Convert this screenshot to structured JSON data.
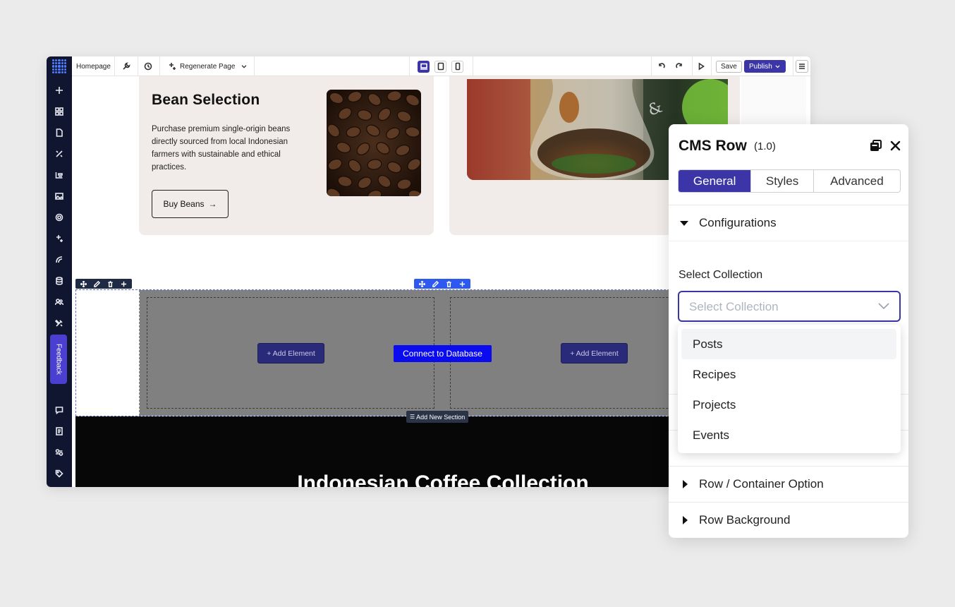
{
  "topbar": {
    "page_name": "Homepage",
    "regenerate_label": "Regenerate Page",
    "save_label": "Save",
    "publish_label": "Publish"
  },
  "sidebar": {
    "feedback_label": "Feedback",
    "icons": [
      "plus-icon",
      "grid-icon",
      "page-icon",
      "design-icon",
      "layout-icon",
      "image-icon",
      "settings-icon",
      "ai-sparkle-icon",
      "integrations-icon",
      "database-icon",
      "users-icon",
      "tools-icon"
    ],
    "bottom_icons": [
      "comment-icon",
      "docs-icon",
      "switch-icon",
      "tag-icon"
    ]
  },
  "canvas": {
    "bean_card": {
      "title": "Bean Selection",
      "description": "Purchase premium single-origin beans directly sourced from local Indonesian farmers with sustainable and ethical practices.",
      "button_label": "Buy Beans"
    },
    "cms_row": {
      "add_element_left": "+ Add Element",
      "add_element_right": "+ Add Element",
      "connect_label": "Connect to Database"
    },
    "add_section_label": "Add New Section",
    "dark_section_title": "Indonesian Coffee Collection"
  },
  "panel": {
    "title": "CMS Row",
    "version": "(1.0)",
    "tabs": [
      {
        "label": "General",
        "active": true
      },
      {
        "label": "Styles",
        "active": false
      },
      {
        "label": "Advanced",
        "active": false
      }
    ],
    "configurations_label": "Configurations",
    "select_label": "Select Collection",
    "select_placeholder": "Select Collection",
    "options": [
      "Posts",
      "Recipes",
      "Projects",
      "Events"
    ],
    "row_option_label": "Row / Container Option",
    "row_background_label": "Row Background"
  },
  "colors": {
    "accent": "#3b35a8",
    "sidebar_bg": "#10162f",
    "connect_button": "#0b0bf0",
    "placeholder_gray": "#808080"
  }
}
